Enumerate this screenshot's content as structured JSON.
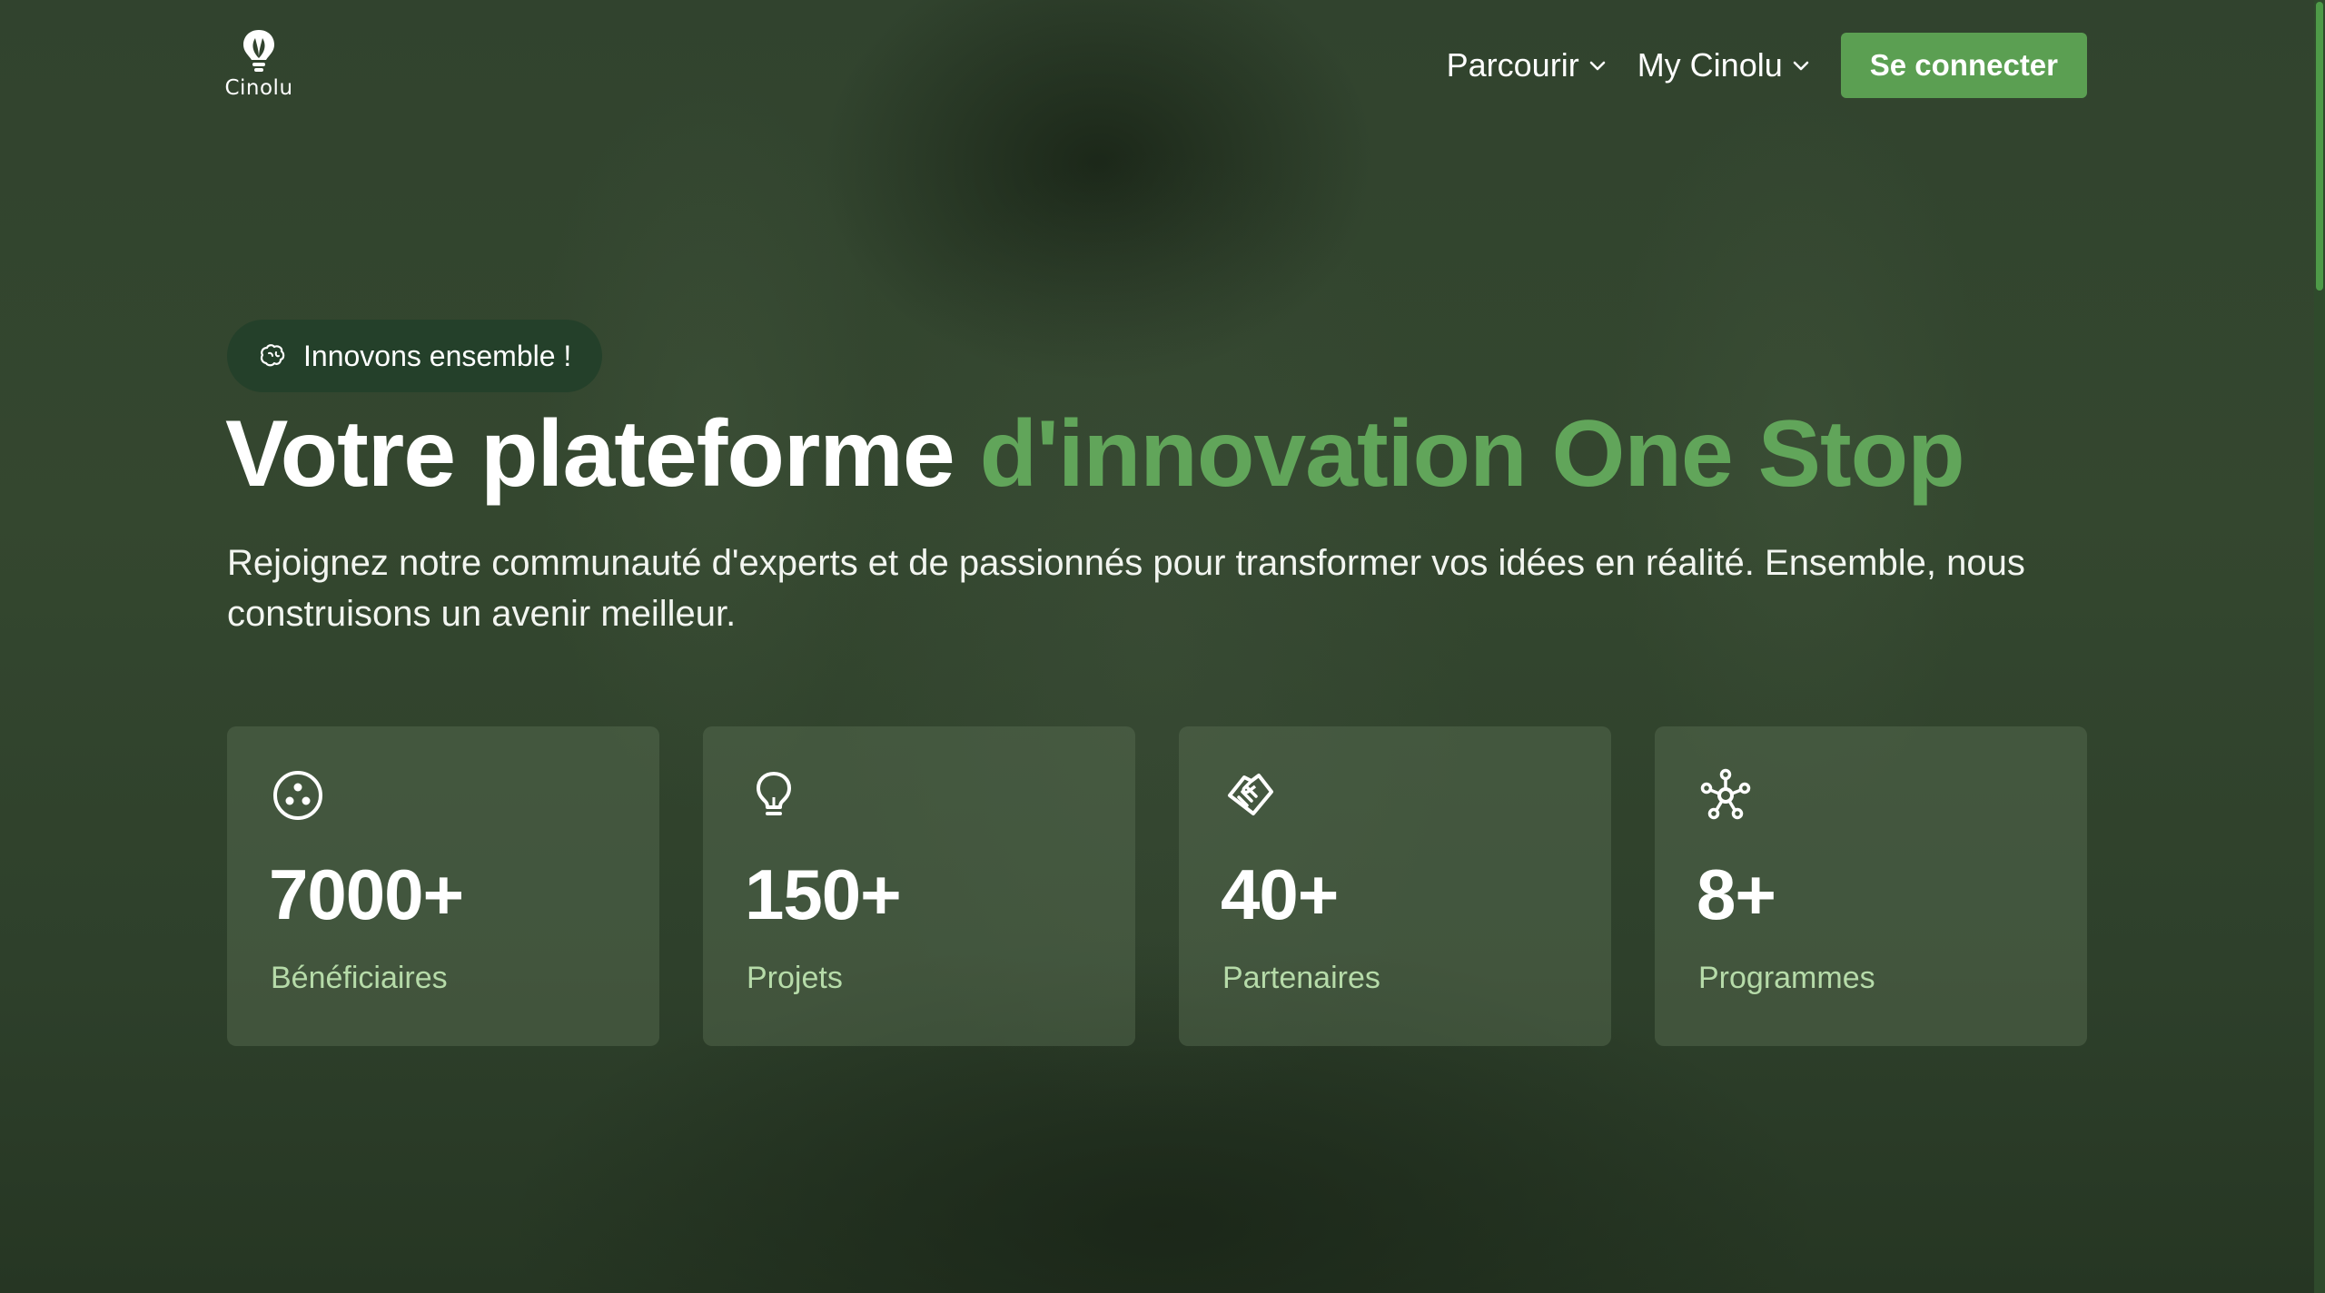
{
  "header": {
    "logo_text": "Cinolu",
    "nav": [
      {
        "label": "Parcourir",
        "icon": "chevron-down-icon"
      },
      {
        "label": "My Cinolu",
        "icon": "chevron-down-icon"
      }
    ],
    "login_label": "Se connecter"
  },
  "hero": {
    "badge_label": "Innovons ensemble !",
    "badge_icon": "brain-icon",
    "title_start": "Votre plateforme",
    "title_accent": "d'innovation One Stop",
    "subtitle": "Rejoignez notre communauté d'experts et de passionnés pour transformer vos idées en réalité. Ensemble, nous construisons un avenir meilleur."
  },
  "stats": [
    {
      "value": "7000+",
      "label": "Bénéficiaires",
      "icon": "users-circle-icon"
    },
    {
      "value": "150+",
      "label": "Projets",
      "icon": "lightbulb-icon"
    },
    {
      "value": "40+",
      "label": "Partenaires",
      "icon": "handshake-icon"
    },
    {
      "value": "8+",
      "label": "Programmes",
      "icon": "network-icon"
    }
  ],
  "colors": {
    "accent": "#61a55a",
    "button": "#5b9f52",
    "stat_label": "#b6dba9",
    "background": "#31432e"
  }
}
